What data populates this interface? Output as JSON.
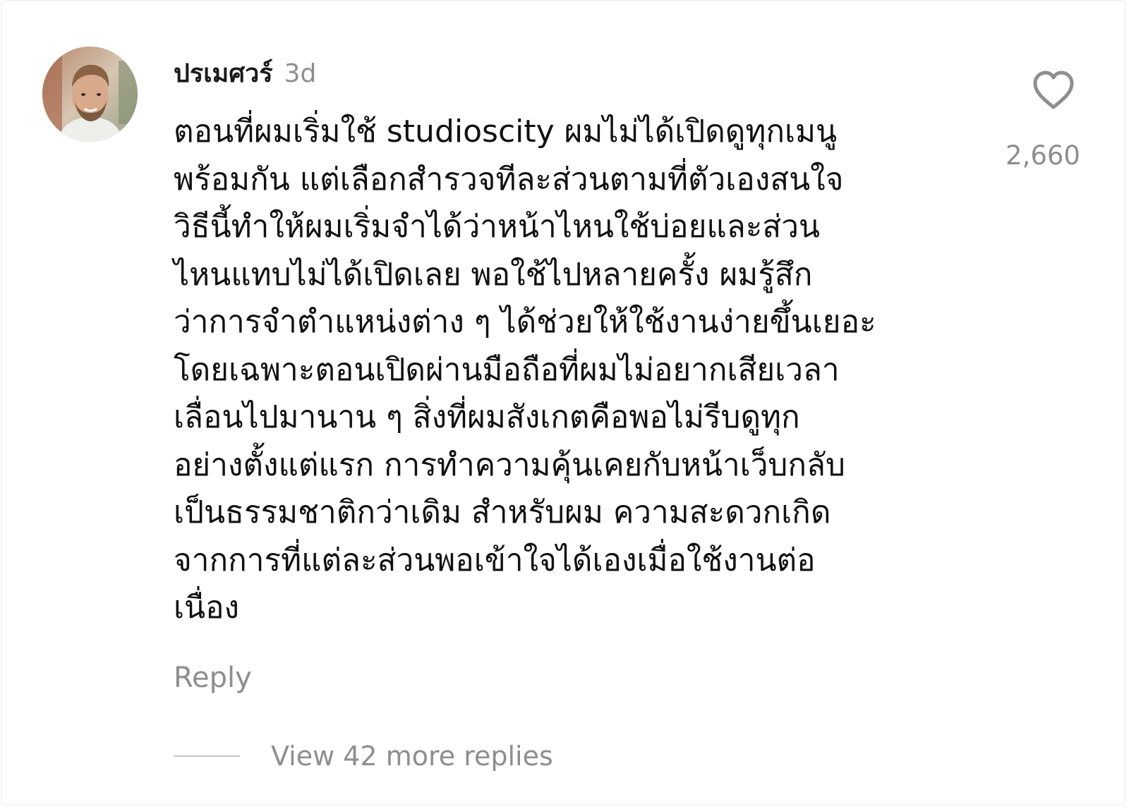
{
  "comment": {
    "author": "ปรเมศวร์",
    "timestamp": "3d",
    "avatar_icon": "user-avatar-photo",
    "text_lines": [
      "ตอนที่ผมเริ่มใช้ studioscity ผมไม่ได้เปิดดูทุกเมนู",
      "พร้อมกัน แต่เลือกสำรวจทีละส่วนตามที่ตัวเองสนใจ",
      "วิธีนี้ทำให้ผมเริ่มจำได้ว่าหน้าไหนใช้บ่อยและส่วน",
      "ไหนแทบไม่ได้เปิดเลย พอใช้ไปหลายครั้ง ผมรู้สึก",
      "ว่าการจำตำแหน่งต่าง ๆ ได้ช่วยให้ใช้งานง่ายขึ้นเยอะ",
      "โดยเฉพาะตอนเปิดผ่านมือถือที่ผมไม่อยากเสียเวลา",
      "เลื่อนไปมานาน ๆ สิ่งที่ผมสังเกตคือพอไม่รีบดูทุก",
      "อย่างตั้งแต่แรก การทำความคุ้นเคยกับหน้าเว็บกลับ",
      "เป็นธรรมชาติกว่าเดิม สำหรับผม ความสะดวกเกิด",
      "จากการที่แต่ละส่วนพอเข้าใจได้เองเมื่อใช้งานต่อ",
      "เนื่อง"
    ],
    "like_icon": "heart-outline-icon",
    "like_count": "2,660",
    "reply_label": "Reply",
    "view_replies_label": "View 42 more replies"
  },
  "colors": {
    "text_primary": "#111111",
    "text_secondary": "#8e8e8e",
    "divider": "#c7c7c7",
    "background": "#ffffff"
  }
}
